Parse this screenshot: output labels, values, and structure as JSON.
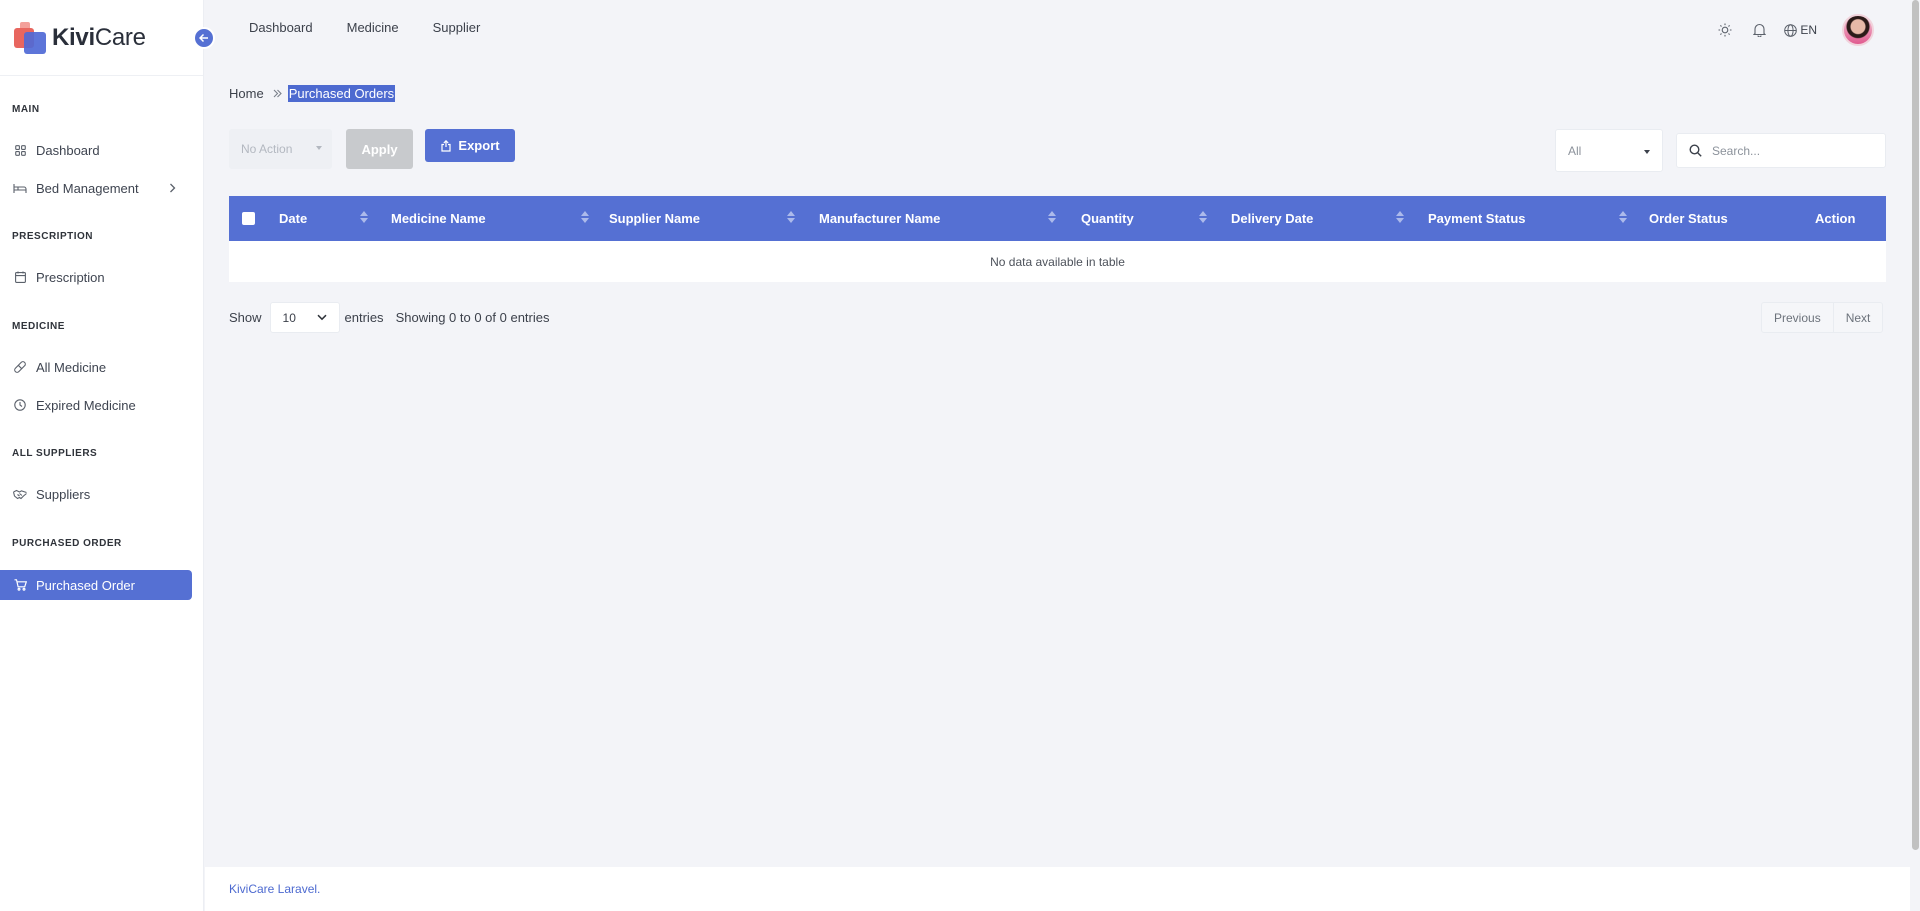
{
  "brand": {
    "name_bold": "Kivi",
    "name_rest": "Care"
  },
  "sidebar": {
    "sections": [
      {
        "title": "MAIN"
      },
      {
        "title": "PRESCRIPTION"
      },
      {
        "title": "MEDICINE"
      },
      {
        "title": "ALL SUPPLIERS"
      },
      {
        "title": "PURCHASED ORDER"
      }
    ],
    "items": [
      {
        "label": "Dashboard",
        "icon": "grid-icon"
      },
      {
        "label": "Bed Management",
        "icon": "bed-icon"
      },
      {
        "label": "Prescription",
        "icon": "calendar-icon"
      },
      {
        "label": "All Medicine",
        "icon": "pill-icon"
      },
      {
        "label": "Expired Medicine",
        "icon": "clock-icon"
      },
      {
        "label": "Suppliers",
        "icon": "handshake-icon"
      },
      {
        "label": "Purchased Order",
        "icon": "cart-icon",
        "active": true
      }
    ]
  },
  "topnav": {
    "items": [
      "Dashboard",
      "Medicine",
      "Supplier"
    ]
  },
  "topright": {
    "lang": "EN"
  },
  "breadcrumb": {
    "home": "Home",
    "current": "Purchased Orders"
  },
  "toolbar": {
    "action_select": "No Action",
    "apply_label": "Apply",
    "export_label": "Export",
    "filter_value": "All",
    "search_placeholder": "Search..."
  },
  "table": {
    "columns": [
      "Date",
      "Medicine Name",
      "Supplier Name",
      "Manufacturer Name",
      "Quantity",
      "Delivery Date",
      "Payment Status",
      "Order Status",
      "Action"
    ],
    "empty_message": "No data available in table"
  },
  "pagination": {
    "show_label": "Show",
    "page_size": "10",
    "entries_label": "entries",
    "info": "Showing 0 to 0 of 0 entries",
    "previous": "Previous",
    "next": "Next"
  },
  "footer": {
    "text": "KiviCare Laravel."
  },
  "colors": {
    "accent": "#5570d3",
    "logo_red": "#e8665f"
  }
}
